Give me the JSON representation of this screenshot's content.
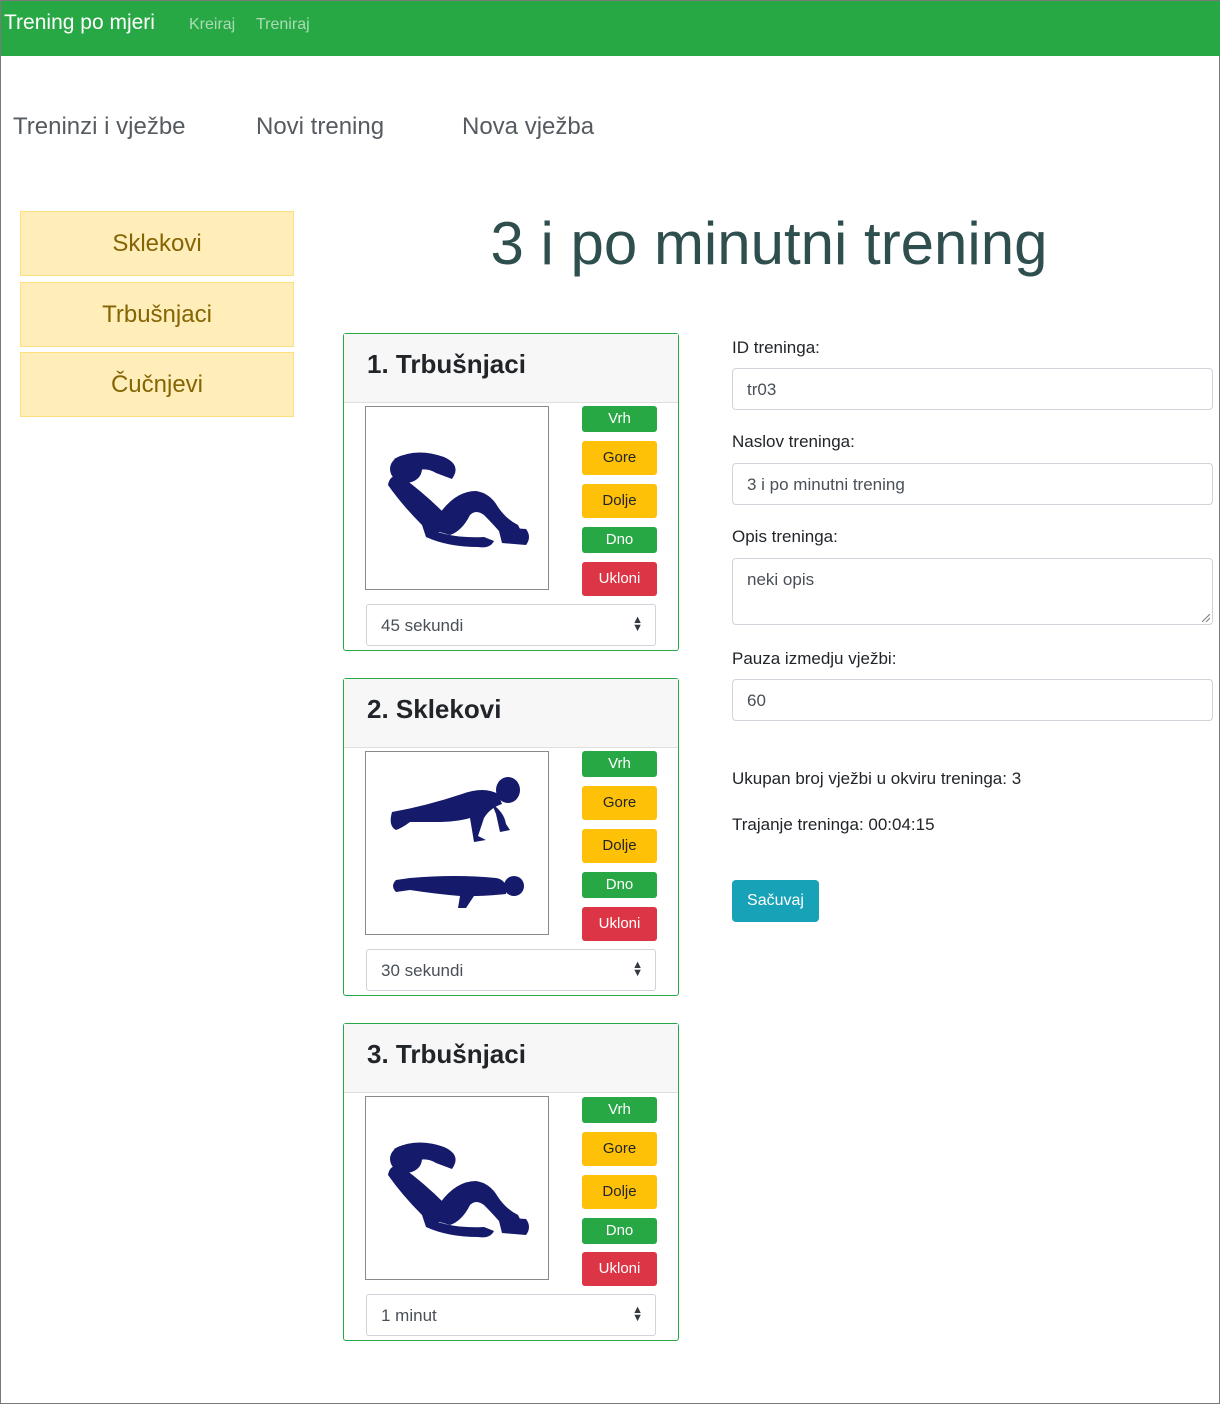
{
  "navbar": {
    "brand": "Trening po mjeri",
    "links": [
      "Kreiraj",
      "Treniraj"
    ],
    "color": "#28a745"
  },
  "subnav": {
    "links": [
      "Treninzi i vježbe",
      "Novi trening",
      "Nova vježba"
    ]
  },
  "sidebar": {
    "items": [
      "Sklekovi",
      "Trbušnjaci",
      "Čučnjevi"
    ]
  },
  "page": {
    "title": "3 i po minutni trening"
  },
  "exercise_buttons": {
    "top": "Vrh",
    "up": "Gore",
    "down": "Dolje",
    "bottom": "Dno",
    "remove": "Ukloni"
  },
  "exercises": [
    {
      "title": "1. Trbušnjaci",
      "image_icon": "situp-silhouette-icon",
      "duration": "45 sekundi"
    },
    {
      "title": "2. Sklekovi",
      "image_icon": "pushup-silhouette-icon",
      "duration": "30 sekundi"
    },
    {
      "title": "3. Trbušnjaci",
      "image_icon": "situp-silhouette-icon",
      "duration": "1 minut"
    }
  ],
  "form": {
    "id_label": "ID treninga:",
    "id_value": "tr03",
    "title_label": "Naslov treninga:",
    "title_value": "3 i po minutni trening",
    "desc_label": "Opis treninga:",
    "desc_value": "neki opis",
    "pause_label": "Pauza izmedju vježbi:",
    "pause_value": "60",
    "total_text": "Ukupan broj vježbi u okviru treninga: 3",
    "duration_text": "Trajanje treninga: 00:04:15",
    "save_label": "Sačuvaj"
  }
}
